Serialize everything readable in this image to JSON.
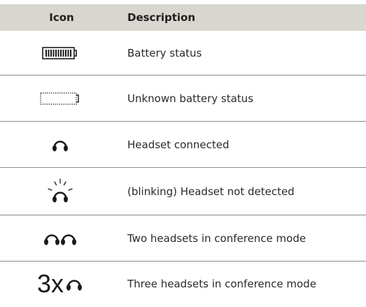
{
  "table": {
    "header": {
      "icon": "Icon",
      "description": "Description"
    },
    "rows": [
      {
        "icon": "battery-full-icon",
        "description": "Battery status"
      },
      {
        "icon": "battery-unknown-icon",
        "description": "Unknown battery status"
      },
      {
        "icon": "headset-icon",
        "description": "Headset connected"
      },
      {
        "icon": "headset-blinking-icon",
        "description": "(blinking) Headset not detected"
      },
      {
        "icon": "two-headsets-icon",
        "description": "Two headsets in conference mode"
      },
      {
        "icon": "three-headsets-icon",
        "icon_text": "3x",
        "description": "Three headsets in conference mode"
      }
    ]
  }
}
